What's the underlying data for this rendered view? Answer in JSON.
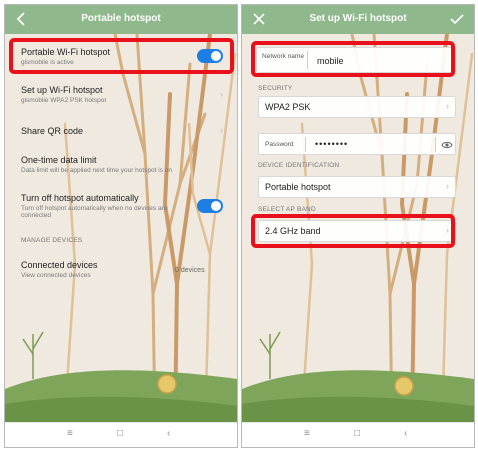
{
  "left": {
    "header": {
      "title": "Portable hotspot",
      "back_icon": "chevron-left-icon"
    },
    "hotspot": {
      "title": "Portable Wi-Fi hotspot",
      "subtitle": "gismobile is active",
      "enabled": true
    },
    "setup": {
      "title": "Set up Wi-Fi hotspot",
      "subtitle": "gismobile WPA2 PSK hotspot"
    },
    "qr": {
      "title": "Share QR code"
    },
    "limit": {
      "title": "One-time data limit",
      "subtitle": "Data limit will be applied next time your hotspot is on"
    },
    "auto_off": {
      "title": "Turn off hotspot automatically",
      "subtitle": "Turn off hotspot automatically when no devices are connected",
      "enabled": true
    },
    "manage_section": "MANAGE DEVICES",
    "connected": {
      "title": "Connected devices",
      "subtitle": "View connected devices",
      "status": "0 devices"
    }
  },
  "right": {
    "header": {
      "title": "Set up Wi-Fi hotspot",
      "close_icon": "close-icon",
      "confirm_icon": "check-icon"
    },
    "network_name": {
      "label": "Network name",
      "value": "mobile"
    },
    "security_section": "SECURITY",
    "security": {
      "value": "WPA2 PSK"
    },
    "password": {
      "label": "Password",
      "value": "••••••••",
      "eye_icon": "eye-icon"
    },
    "device_section": "DEVICE IDENTIFICATION",
    "device": {
      "value": "Portable hotspot"
    },
    "band_section": "SELECT AP BAND",
    "band": {
      "value": "2.4 GHz band"
    }
  },
  "navbar": {
    "menu_icon": "menu-icon",
    "home_icon": "home-square-icon",
    "back_icon": "back-triangle-icon"
  },
  "colors": {
    "header": "#8fb98c",
    "toggle": "#1d7fe3",
    "highlight": "#e8101a",
    "grass": "#7fa55a"
  }
}
